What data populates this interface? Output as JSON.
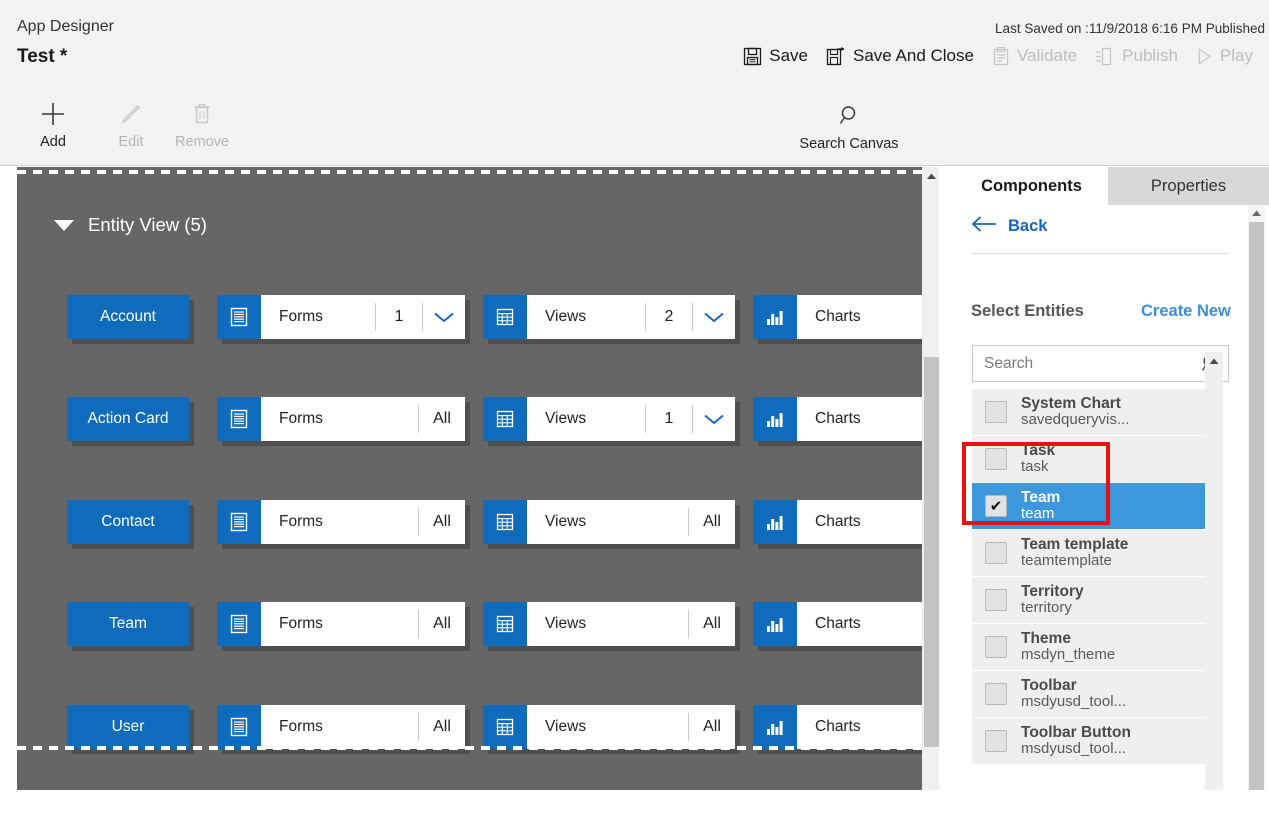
{
  "header": {
    "app_label": "App Designer",
    "app_title": "Test *",
    "saved_status": "Last Saved on :11/9/2018 6:16 PM Published",
    "commands": [
      {
        "label": "Save",
        "icon": "save-icon",
        "disabled": false
      },
      {
        "label": "Save And Close",
        "icon": "save-and-close-icon",
        "disabled": false
      },
      {
        "label": "Validate",
        "icon": "validate-icon",
        "disabled": true
      },
      {
        "label": "Publish",
        "icon": "publish-icon",
        "disabled": true
      },
      {
        "label": "Play",
        "icon": "play-icon",
        "disabled": true
      }
    ]
  },
  "toolbar": {
    "add_label": "Add",
    "edit_label": "Edit",
    "remove_label": "Remove",
    "search_canvas_label": "Search Canvas"
  },
  "canvas": {
    "group_title": "Entity View (5)",
    "group_expanded": true,
    "rows": [
      {
        "entity": "Account",
        "forms": {
          "label": "Forms",
          "count": "1",
          "has_chevron": true
        },
        "views": {
          "label": "Views",
          "count": "2",
          "has_chevron": true
        },
        "charts": {
          "label": "Charts",
          "count": "",
          "has_chevron": false
        }
      },
      {
        "entity": "Action Card",
        "forms": {
          "label": "Forms",
          "count": "All",
          "has_chevron": false
        },
        "views": {
          "label": "Views",
          "count": "1",
          "has_chevron": true
        },
        "charts": {
          "label": "Charts",
          "count": "",
          "has_chevron": false
        }
      },
      {
        "entity": "Contact",
        "forms": {
          "label": "Forms",
          "count": "All",
          "has_chevron": false
        },
        "views": {
          "label": "Views",
          "count": "All",
          "has_chevron": false
        },
        "charts": {
          "label": "Charts",
          "count": "",
          "has_chevron": false
        }
      },
      {
        "entity": "Team",
        "forms": {
          "label": "Forms",
          "count": "All",
          "has_chevron": false
        },
        "views": {
          "label": "Views",
          "count": "All",
          "has_chevron": false
        },
        "charts": {
          "label": "Charts",
          "count": "",
          "has_chevron": false
        }
      },
      {
        "entity": "User",
        "forms": {
          "label": "Forms",
          "count": "All",
          "has_chevron": false
        },
        "views": {
          "label": "Views",
          "count": "All",
          "has_chevron": false
        },
        "charts": {
          "label": "Charts",
          "count": "",
          "has_chevron": false
        }
      }
    ]
  },
  "panel": {
    "tabs": [
      {
        "label": "Components",
        "active": true
      },
      {
        "label": "Properties",
        "active": false
      }
    ],
    "back_label": "Back",
    "select_entities_label": "Select Entities",
    "create_new_label": "Create New",
    "search_placeholder": "Search",
    "search_value": "",
    "entities": [
      {
        "name": "System Chart",
        "logical": "savedqueryvis...",
        "checked": false,
        "selected": false
      },
      {
        "name": "Task",
        "logical": "task",
        "checked": false,
        "selected": false
      },
      {
        "name": "Team",
        "logical": "team",
        "checked": true,
        "selected": true
      },
      {
        "name": "Team template",
        "logical": "teamtemplate",
        "checked": false,
        "selected": false
      },
      {
        "name": "Territory",
        "logical": "territory",
        "checked": false,
        "selected": false
      },
      {
        "name": "Theme",
        "logical": "msdyn_theme",
        "checked": false,
        "selected": false
      },
      {
        "name": "Toolbar",
        "logical": "msdyusd_tool...",
        "checked": false,
        "selected": false
      },
      {
        "name": "Toolbar Button",
        "logical": "msdyusd_tool...",
        "checked": false,
        "selected": false
      }
    ],
    "checkmark_glyph": "✔"
  },
  "colors": {
    "brand_blue": "#0f6cbd",
    "link_blue": "#3b8ede",
    "canvas_gray": "#666666",
    "selection_blue": "#3d97dd",
    "annotation_red": "#e8110f",
    "header_gray": "#f2f2f2"
  }
}
